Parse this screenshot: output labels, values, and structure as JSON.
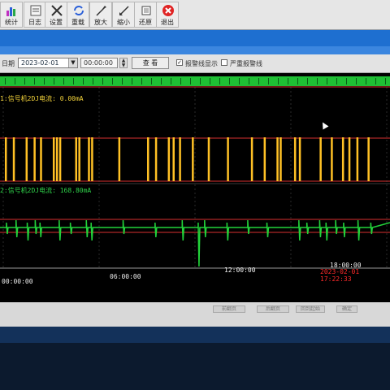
{
  "toolbar": {
    "buttons": [
      {
        "label": "统计",
        "icon": "bar-chart-icon"
      },
      {
        "label": "日志",
        "icon": "log-icon"
      },
      {
        "label": "设置",
        "icon": "settings-icon"
      },
      {
        "label": "重载",
        "icon": "reload-icon"
      },
      {
        "label": "放大",
        "icon": "zoom-in-icon"
      },
      {
        "label": "缩小",
        "icon": "zoom-out-icon"
      },
      {
        "label": "还原",
        "icon": "restore-icon"
      },
      {
        "label": "退出",
        "icon": "exit-icon"
      }
    ]
  },
  "filter": {
    "date_label": "日期",
    "date_value": "2023-02-01",
    "time_value": "00:00:00",
    "query_label": "查 看",
    "alarm_line_label": "报警线显示",
    "alarm_line_checked": true,
    "severe_alarm_label": "严重报警线",
    "severe_alarm_checked": false
  },
  "charts": {
    "top_title": "1:信号机2DJ电流: 0.00mA",
    "bottom_title": "2:信号机2DJ电流: 168.80mA",
    "colors": {
      "top_pulse": "#ffc125",
      "bottom_trace": "#22d33a",
      "alarm": "#ff2a2a",
      "grid": "#555555",
      "label_top": "#f2d23a",
      "label_bottom": "#2fd24a"
    }
  },
  "x_axis": {
    "ticks": [
      "00:00:00",
      "06:00:00",
      "12:00:00",
      "18:00:00"
    ]
  },
  "timestamp": "2023-02-01 17:22:33",
  "footer": {
    "buttons": [
      "前翻页",
      "后翻页",
      "回到起始",
      "确定"
    ]
  },
  "chart_data": [
    {
      "type": "line",
      "title": "1:信号机2DJ电流: 0.00mA",
      "series": [
        {
          "name": "信号机2DJ电流",
          "pulse_times_hours": [
            0.1,
            0.6,
            1.4,
            1.9,
            2.3,
            3.1,
            3.3,
            3.5,
            4.5,
            4.7,
            5.3,
            5.5,
            7.2,
            9.0,
            9.5,
            10.3,
            10.6,
            11.0,
            11.8,
            12.8,
            14.0,
            15.5,
            16.3,
            17.1,
            17.3,
            18.2,
            18.5,
            19.8,
            20.5,
            21.2,
            21.6,
            22.1,
            22.8
          ]
        }
      ],
      "xlim": [
        0,
        24
      ]
    },
    {
      "type": "line",
      "title": "2:信号机2DJ电流: 168.80mA",
      "series": [
        {
          "name": "信号机2DJ电流",
          "spike_times_hours": [
            0.2,
            0.8,
            1.5,
            2.0,
            2.3,
            3.5,
            4.2,
            5.2,
            5.5,
            7.5,
            9.5,
            11.2,
            12.2,
            12.6,
            14.0,
            15.3,
            16.5,
            18.5,
            19.0,
            19.8,
            20.2,
            20.8,
            21.3,
            22.2,
            23.0
          ]
        }
      ],
      "xlim": [
        0,
        24
      ]
    }
  ]
}
